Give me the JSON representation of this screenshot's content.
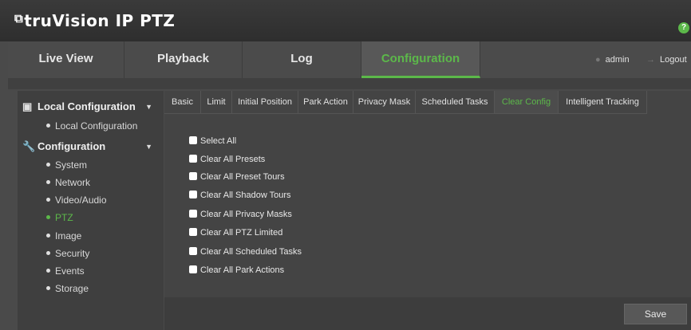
{
  "header": {
    "logo_text": "truVision IP PTZ",
    "help_label": "?"
  },
  "nav": {
    "tabs": [
      {
        "label": "Live View"
      },
      {
        "label": "Playback"
      },
      {
        "label": "Log"
      },
      {
        "label": "Configuration",
        "active": true
      }
    ],
    "user": "admin",
    "logout": "Logout"
  },
  "sidebar": {
    "local_header": "Local Configuration",
    "local_items": [
      "Local Configuration"
    ],
    "config_header": "Configuration",
    "config_items": [
      "System",
      "Network",
      "Video/Audio",
      "PTZ",
      "Image",
      "Security",
      "Events",
      "Storage"
    ],
    "active_item": "PTZ"
  },
  "main": {
    "subtabs": [
      "Basic",
      "Limit",
      "Initial Position",
      "Park Action",
      "Privacy Mask",
      "Scheduled Tasks",
      "Clear Config",
      "Intelligent Tracking"
    ],
    "active_subtab": "Clear Config",
    "options": [
      "Select All",
      "Clear All Presets",
      "Clear All Preset Tours",
      "Clear All Shadow Tours",
      "Clear All Privacy Masks",
      "Clear All PTZ Limited",
      "Clear All Scheduled Tasks",
      "Clear All Park Actions"
    ],
    "save_label": "Save"
  },
  "colors": {
    "accent": "#5cb84a",
    "background": "#4a4a4a",
    "header": "#333333"
  }
}
